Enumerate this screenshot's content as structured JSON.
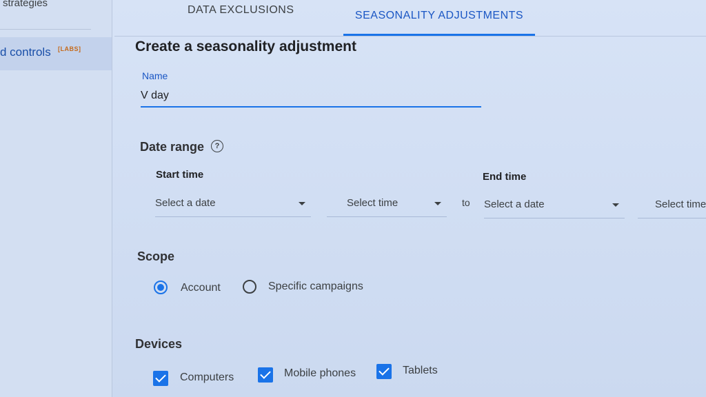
{
  "sidebar": {
    "items": [
      {
        "label": "strategies"
      },
      {
        "label": "d controls",
        "badge": "[LABS]"
      }
    ]
  },
  "tabs": [
    {
      "label": "DATA EXCLUSIONS"
    },
    {
      "label": "SEASONALITY ADJUSTMENTS",
      "active": true
    }
  ],
  "form": {
    "title": "Create a seasonality adjustment",
    "name_label": "Name",
    "name_value": "V day",
    "date_range": {
      "title": "Date range",
      "help_icon": "?",
      "start_label": "Start time",
      "end_label": "End time",
      "start_date_placeholder": "Select a date",
      "start_time_placeholder": "Select time",
      "to": "to",
      "end_date_placeholder": "Select a date",
      "end_time_placeholder": "Select time"
    },
    "scope": {
      "title": "Scope",
      "options": [
        {
          "label": "Account",
          "selected": true
        },
        {
          "label": "Specific campaigns",
          "selected": false
        }
      ]
    },
    "devices": {
      "title": "Devices",
      "options": [
        {
          "label": "Computers",
          "checked": true
        },
        {
          "label": "Mobile phones",
          "checked": true
        },
        {
          "label": "Tablets",
          "checked": true
        }
      ]
    }
  },
  "colors": {
    "accent": "#1a73e8",
    "labs_badge": "#c56a1a"
  }
}
